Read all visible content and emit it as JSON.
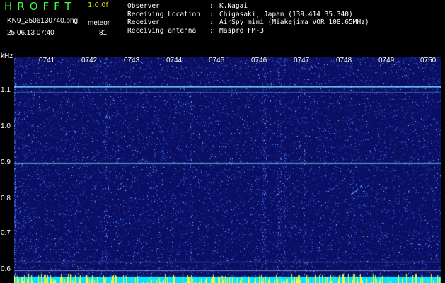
{
  "header": {
    "app_title": "HROFFT",
    "version": "1.0.0f",
    "filename": "KN9_2506130740.png",
    "datetime": "25.06.13 07:40",
    "meteor_label": "meteor",
    "meteor_count": "81"
  },
  "info": [
    {
      "key": "Observer",
      "sep": ":",
      "value": "K.Nagai"
    },
    {
      "key": "Receiving Location",
      "sep": ":",
      "value": "Chigasaki, Japan (139.414 35.340)"
    },
    {
      "key": "Receiver",
      "sep": ":",
      "value": "AirSpy mini (Miakejima VOR 108.65MHz)"
    },
    {
      "key": "Receiving antenna",
      "sep": ":",
      "value": "Maspro FM-3"
    }
  ],
  "axis": {
    "y_unit": "kHz",
    "y_ticks": [
      "1.1",
      "1.0",
      "0.9",
      "0.8",
      "0.7",
      "0.6"
    ],
    "time_ticks": [
      "0741",
      "0742",
      "0743",
      "0744",
      "0745",
      "0746",
      "0747",
      "0748",
      "0749",
      "0750"
    ]
  },
  "colors": {
    "background": "#0b0f63",
    "noise": "#3b7cff",
    "carrier": "#7fe8ff",
    "bottom_band": "#00e5ff",
    "bottom_spikes": "#f5ff3a",
    "title_green": "#3cff3c",
    "version_yellow": "#d8d800"
  }
}
